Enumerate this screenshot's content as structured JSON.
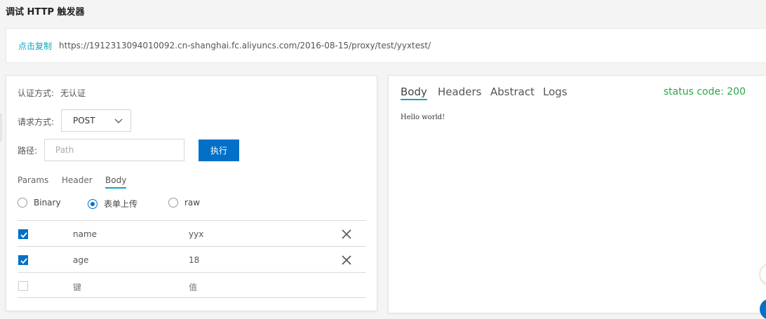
{
  "page": {
    "title": "调试 HTTP 触发器"
  },
  "url_bar": {
    "copy_label": "点击复制",
    "url": "https://1912313094010092.cn-shanghai.fc.aliyuncs.com/2016-08-15/proxy/test/yyxtest/"
  },
  "request": {
    "auth_label": "认证方式:",
    "auth_value": "无认证",
    "method_label": "请求方式:",
    "method_value": "POST",
    "path_label": "路径:",
    "path_placeholder": "Path",
    "path_value": "",
    "run_label": "执行",
    "tabs": [
      {
        "label": "Params",
        "active": false
      },
      {
        "label": "Header",
        "active": false
      },
      {
        "label": "Body",
        "active": true
      }
    ],
    "body_types": [
      {
        "label": "Binary",
        "checked": false
      },
      {
        "label": "表单上传",
        "checked": true
      },
      {
        "label": "raw",
        "checked": false
      }
    ],
    "form_rows": [
      {
        "checked": true,
        "key": "name",
        "value": "yyx"
      },
      {
        "checked": true,
        "key": "age",
        "value": "18"
      },
      {
        "checked": false,
        "key": "键",
        "value": "值"
      }
    ]
  },
  "response": {
    "tabs": [
      {
        "label": "Body",
        "active": true
      },
      {
        "label": "Headers",
        "active": false
      },
      {
        "label": "Abstract",
        "active": false
      },
      {
        "label": "Logs",
        "active": false
      }
    ],
    "status_text": "status code: 200",
    "status_color": "#28a745",
    "body_text": "Hello world!"
  },
  "colors": {
    "primary": "#0270c6",
    "accent": "#0fa7c5"
  }
}
